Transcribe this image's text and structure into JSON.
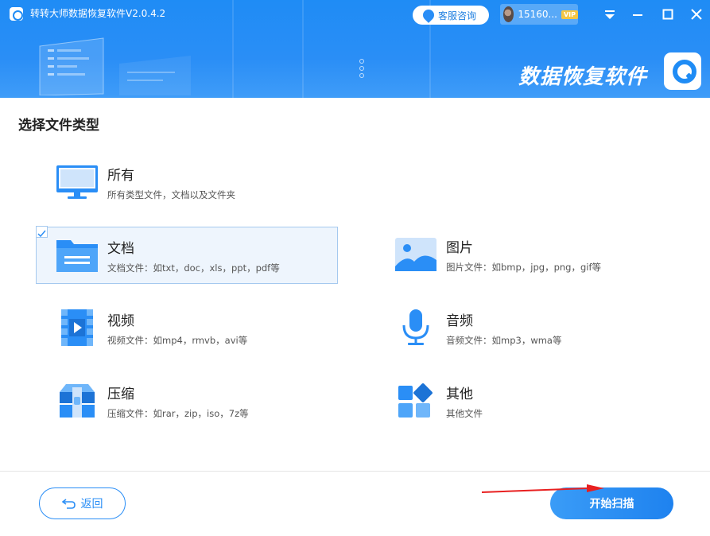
{
  "window": {
    "title": "转转大师数据恢复软件V2.0.4.2",
    "service_label": "客服咨询",
    "user_name": "15160...",
    "vip_badge": "VIP"
  },
  "banner": {
    "brand_text": "数据恢复软件"
  },
  "main": {
    "section_title": "选择文件类型",
    "file_types": [
      {
        "label": "所有",
        "desc": "所有类型文件，文档以及文件夹",
        "icon": "monitor-icon"
      },
      {
        "label": "文档",
        "desc": "文档文件：如txt，doc，xls，ppt，pdf等",
        "icon": "folder-icon",
        "selected": true
      },
      {
        "label": "图片",
        "desc": "图片文件：如bmp，jpg，png，gif等",
        "icon": "image-icon"
      },
      {
        "label": "视频",
        "desc": "视频文件：如mp4，rmvb，avi等",
        "icon": "video-icon"
      },
      {
        "label": "音频",
        "desc": "音频文件：如mp3，wma等",
        "icon": "microphone-icon"
      },
      {
        "label": "压缩",
        "desc": "压缩文件：如rar，zip，iso，7z等",
        "icon": "archive-icon"
      },
      {
        "label": "其他",
        "desc": "其他文件",
        "icon": "apps-icon"
      }
    ]
  },
  "footer": {
    "back_label": "返回",
    "start_label": "开始扫描"
  },
  "colors": {
    "primary": "#2a8ef6",
    "header": "#1f8cf5",
    "selected_bg": "#eef5fd",
    "selected_border": "#a5c9ef",
    "annotation_arrow": "#e82020"
  }
}
